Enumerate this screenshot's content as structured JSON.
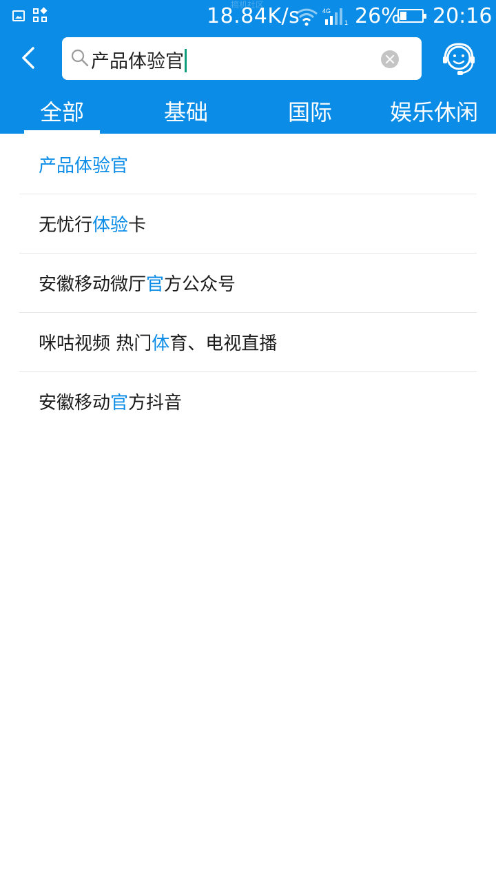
{
  "status_bar": {
    "watermark": "搞机社区",
    "net_speed": "18.84K/s",
    "network_type": "4G",
    "sim_slot": "1",
    "battery_percent": "26%",
    "time": "20:16",
    "icons": [
      "image-icon",
      "apps-icon",
      "wifi-icon",
      "signal-icon",
      "battery-icon"
    ]
  },
  "search": {
    "value": "产品体验官"
  },
  "tabs": [
    {
      "label": "全部",
      "active": true
    },
    {
      "label": "基础",
      "active": false
    },
    {
      "label": "国际",
      "active": false
    },
    {
      "label": "娱乐休闲",
      "active": false
    }
  ],
  "results": [
    {
      "parts": [
        {
          "text": "产品体验官",
          "highlight": true
        }
      ]
    },
    {
      "parts": [
        {
          "text": "无忧行",
          "highlight": false
        },
        {
          "text": "体验",
          "highlight": true
        },
        {
          "text": "卡",
          "highlight": false
        }
      ]
    },
    {
      "parts": [
        {
          "text": "安徽移动微厅",
          "highlight": false
        },
        {
          "text": "官",
          "highlight": true
        },
        {
          "text": "方公众号",
          "highlight": false
        }
      ]
    },
    {
      "parts": [
        {
          "text": "咪咕视频 热门",
          "highlight": false
        },
        {
          "text": "体",
          "highlight": true
        },
        {
          "text": "育、电视直播",
          "highlight": false
        }
      ]
    },
    {
      "parts": [
        {
          "text": "安徽移动",
          "highlight": false
        },
        {
          "text": "官",
          "highlight": true
        },
        {
          "text": "方抖音",
          "highlight": false
        }
      ]
    }
  ],
  "colors": {
    "primary": "#0b8ce6",
    "highlight": "#0b8ce6",
    "text": "#1a1a1a",
    "divider": "#e8e8e8",
    "caret": "#0f9e7d"
  }
}
